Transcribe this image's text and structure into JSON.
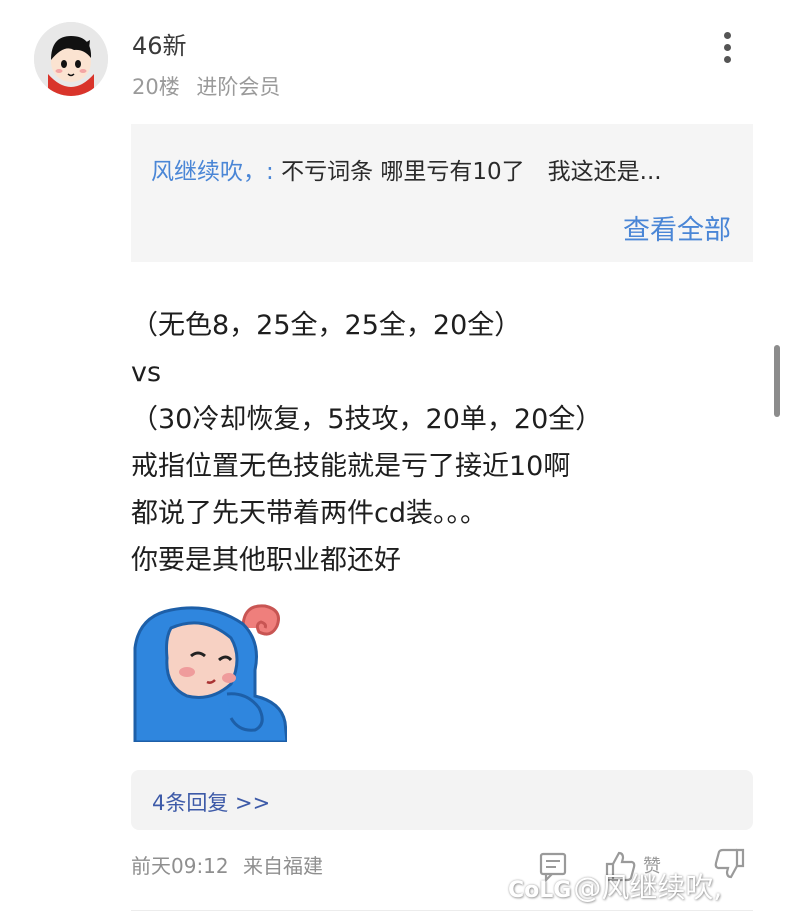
{
  "post": {
    "username": "46新",
    "floor": "20楼",
    "member_level": "进阶会员"
  },
  "quote": {
    "author": "风继续吹，:",
    "text": "不亏词条 哪里亏有10了　我这还是...",
    "view_all": "查看全部"
  },
  "content": {
    "lines": [
      "（无色8，25全，25全，20全）",
      "vs",
      "（30冷却恢复，5技攻，20单，20全）",
      "戒指位置无色技能就是亏了接近10啊",
      "都说了先天带着两件cd装。。。",
      "你要是其他职业都还好"
    ]
  },
  "replies": {
    "label": "4条回复 >>"
  },
  "footer": {
    "time": "前天09:12",
    "location": "来自福建",
    "like_label": "赞"
  },
  "watermark": {
    "logo": "CoLG",
    "text": "@风继续吹,"
  },
  "icons": {
    "more": "more-vertical-icon",
    "reply": "reply-icon",
    "like": "thumbs-up-icon",
    "dislike": "thumbs-down-icon"
  },
  "colors": {
    "accent_blue": "#4a86d6",
    "link_blue": "#3d5aa8",
    "meta_gray": "#9a9a9a"
  }
}
